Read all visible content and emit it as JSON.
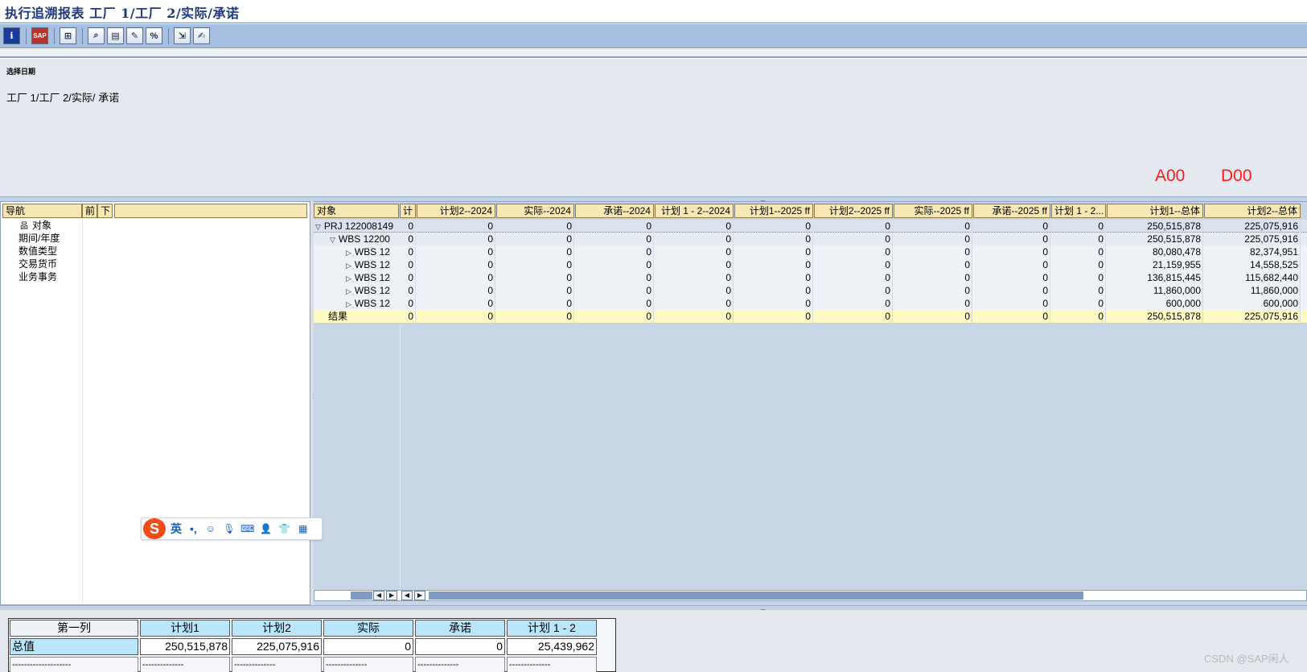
{
  "window": {
    "title": "执行追溯报表 工厂 1/工厂 2/实际/承诺"
  },
  "toolbar": {
    "buttons": [
      {
        "icon": "info-icon",
        "glyph": "i"
      },
      {
        "icon": "report-icon",
        "glyph": "SAP"
      },
      {
        "icon": "hierarchy-icon",
        "glyph": "⊞"
      },
      {
        "icon": "find-icon",
        "glyph": "⌕"
      },
      {
        "icon": "layout-icon",
        "glyph": "▤"
      },
      {
        "icon": "edit-icon",
        "glyph": "✎"
      },
      {
        "icon": "count-icon",
        "glyph": "%"
      },
      {
        "icon": "export-icon",
        "glyph": "⇲"
      },
      {
        "icon": "note-icon",
        "glyph": "✍"
      }
    ]
  },
  "header": {
    "section_label": "选择日期",
    "description": "工厂 1/工厂 2/实际/ 承诺",
    "marker_a": "A00",
    "marker_d": "D00"
  },
  "nav": {
    "columns": [
      "导航",
      "前",
      "下",
      ""
    ],
    "items": [
      {
        "label": "对象",
        "icon": "hierarchy-icon"
      },
      {
        "label": "期间/年度"
      },
      {
        "label": "数值类型"
      },
      {
        "label": "交易货币"
      },
      {
        "label": "业务事务"
      }
    ]
  },
  "grid": {
    "columns": [
      "对象",
      "计",
      "计划2--2024",
      "实际--2024",
      "承诺--2024",
      "计划 1 - 2--2024",
      "计划1--2025 ff",
      "计划2--2025 ff",
      "实际--2025 ff",
      "承诺--2025 ff",
      "计划 1 - 2...",
      "计划1--总体",
      "计划2--总体"
    ],
    "rows": [
      {
        "type": "top",
        "object": "PRJ 122008149",
        "values": [
          "0",
          "0",
          "0",
          "0",
          "0",
          "0",
          "0",
          "0",
          "0",
          "0",
          "250,515,878",
          "225,075,916"
        ]
      },
      {
        "type": "wbs",
        "object": "WBS 12200",
        "values": [
          "0",
          "0",
          "0",
          "0",
          "0",
          "0",
          "0",
          "0",
          "0",
          "0",
          "250,515,878",
          "225,075,916"
        ]
      },
      {
        "type": "child",
        "object": "WBS 12",
        "values": [
          "0",
          "0",
          "0",
          "0",
          "0",
          "0",
          "0",
          "0",
          "0",
          "0",
          "80,080,478",
          "82,374,951"
        ]
      },
      {
        "type": "child",
        "object": "WBS 12",
        "values": [
          "0",
          "0",
          "0",
          "0",
          "0",
          "0",
          "0",
          "0",
          "0",
          "0",
          "21,159,955",
          "14,558,525"
        ]
      },
      {
        "type": "child",
        "object": "WBS 12",
        "values": [
          "0",
          "0",
          "0",
          "0",
          "0",
          "0",
          "0",
          "0",
          "0",
          "0",
          "136,815,445",
          "115,682,440"
        ]
      },
      {
        "type": "child",
        "object": "WBS 12",
        "values": [
          "0",
          "0",
          "0",
          "0",
          "0",
          "0",
          "0",
          "0",
          "0",
          "0",
          "11,860,000",
          "11,860,000"
        ]
      },
      {
        "type": "child",
        "object": "WBS 12",
        "values": [
          "0",
          "0",
          "0",
          "0",
          "0",
          "0",
          "0",
          "0",
          "0",
          "0",
          "600,000",
          "600,000"
        ]
      },
      {
        "type": "result",
        "object": "结果",
        "values": [
          "0",
          "0",
          "0",
          "0",
          "0",
          "0",
          "0",
          "0",
          "0",
          "0",
          "250,515,878",
          "225,075,916"
        ]
      }
    ]
  },
  "summary": {
    "headers": [
      "第一列",
      "计划1",
      "计划2",
      "实际",
      "承诺",
      "计划 1 - 2"
    ],
    "row_label": "总值",
    "values": [
      "250,515,878",
      "225,075,916",
      "0",
      "0",
      "25,439,962"
    ],
    "dash_first": "--------------------",
    "dash_other": "--------------"
  },
  "ime": {
    "logo": "S",
    "mode": "英",
    "punct": "•,"
  },
  "watermark": "CSDN @SAP闲人"
}
